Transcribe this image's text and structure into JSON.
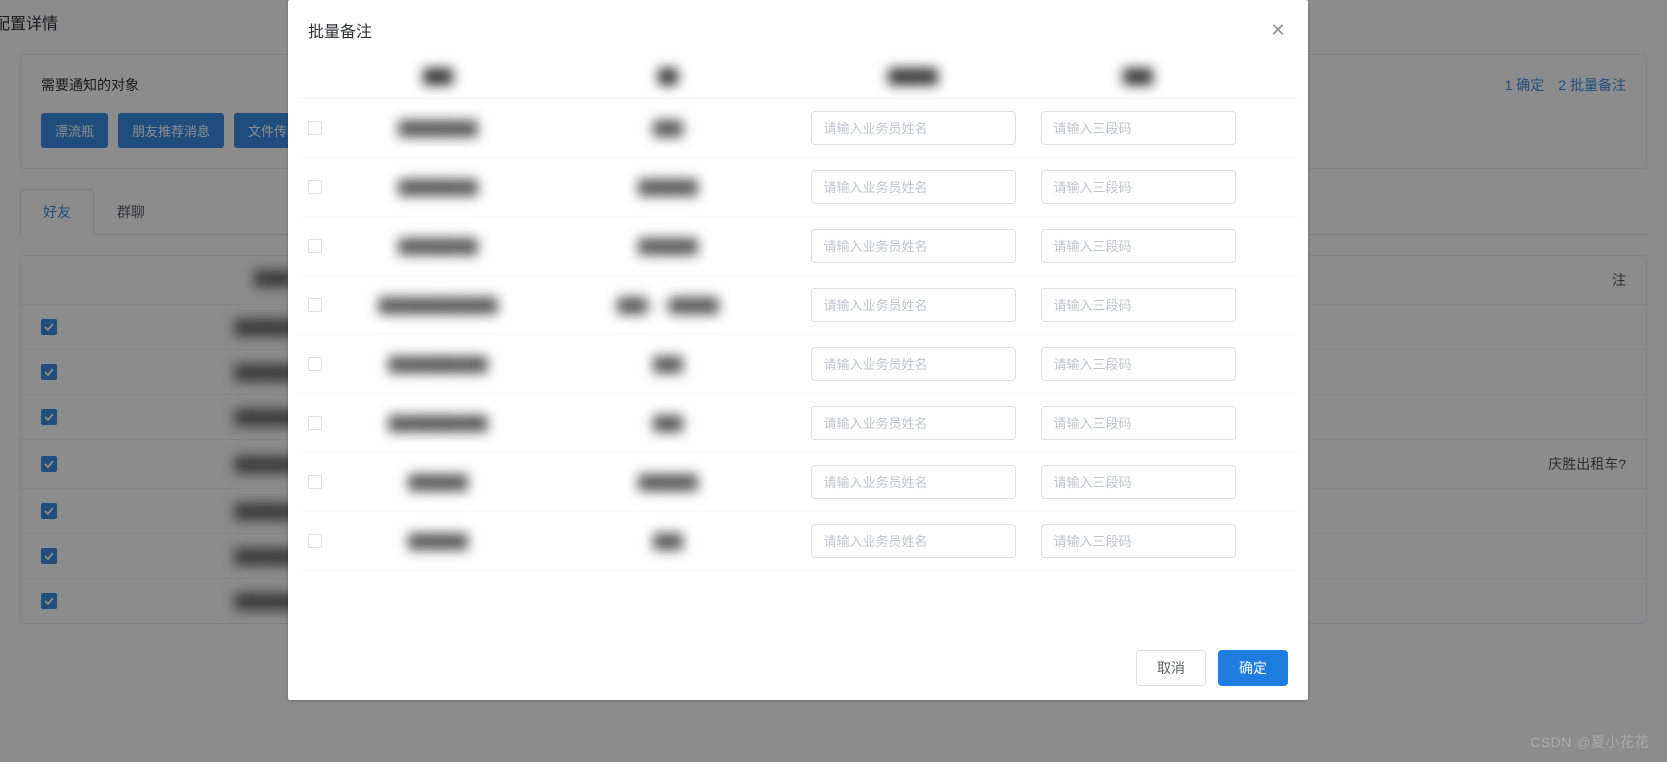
{
  "page": {
    "title": "配置详情",
    "section_label": "需要通知的对象",
    "actions": {
      "confirm": "1 确定",
      "batch": "2 批量备注"
    },
    "tags": [
      "漂流瓶",
      "朋友推荐消息",
      "文件传输"
    ],
    "tabs": {
      "friends": "好友",
      "groups": "群聊"
    },
    "bg_col_remark": "注",
    "bg_last_cell": "庆胜出租车?",
    "bg_rows": 7
  },
  "modal": {
    "title": "批量备注",
    "headers": {
      "c1": "███",
      "c2": "██",
      "c3": "█████",
      "c4": "███"
    },
    "placeholder_agent": "请输入业务员姓名",
    "placeholder_code": "请输入三段码",
    "rows": [
      {
        "c1": "████████",
        "c2": "███"
      },
      {
        "c1": "████████",
        "c2": "██████"
      },
      {
        "c1": "████████",
        "c2": "██████"
      },
      {
        "c1": "████████████",
        "c2": "███ — █████"
      },
      {
        "c1": "██████████",
        "c2": "███"
      },
      {
        "c1": "██████████",
        "c2": "███"
      },
      {
        "c1": "██████",
        "c2": "██████"
      },
      {
        "c1": "██████",
        "c2": "███"
      }
    ],
    "cancel": "取消",
    "confirm": "确定"
  },
  "watermark": "CSDN @夏小花花"
}
